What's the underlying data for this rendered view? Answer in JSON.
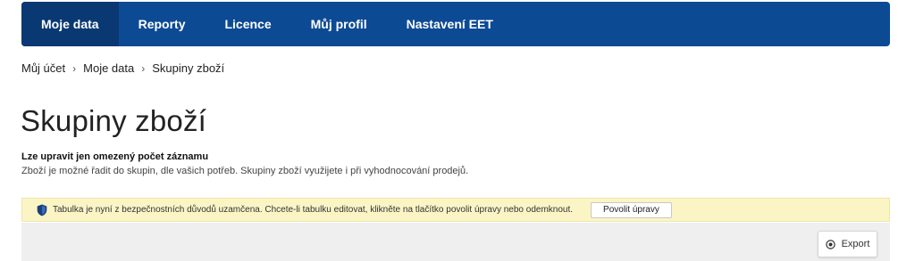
{
  "nav": {
    "items": [
      {
        "label": "Moje data"
      },
      {
        "label": "Reporty"
      },
      {
        "label": "Licence"
      },
      {
        "label": "Můj profil"
      },
      {
        "label": "Nastavení EET"
      }
    ],
    "active_index": 0
  },
  "breadcrumb": {
    "items": [
      "Můj účet",
      "Moje data",
      "Skupiny zboží"
    ],
    "separator": "›"
  },
  "page": {
    "title": "Skupiny zboží",
    "info_heading": "Lze upravit jen omezený počet záznamu",
    "info_text": "Zboží je možné řadit do skupin, dle vašich potřeb. Skupiny zboží využijete i při vyhodnocování prodejů."
  },
  "alert": {
    "text": "Tabulka je nyní z bezpečnostních důvodů uzamčena. Chcete-li tabulku editovat, klikněte na tlačítko povolit úpravy nebo odemknout.",
    "button_label": "Povolit úpravy",
    "icon": "shield-icon"
  },
  "toolbar": {
    "export_label": "Export",
    "export_icon": "circle-dot-icon"
  },
  "colors": {
    "nav_bg": "#0d4a94",
    "nav_active_bg": "#0a3873",
    "alert_bg": "#fbf5c6",
    "toolbar_bg": "#efefef"
  }
}
